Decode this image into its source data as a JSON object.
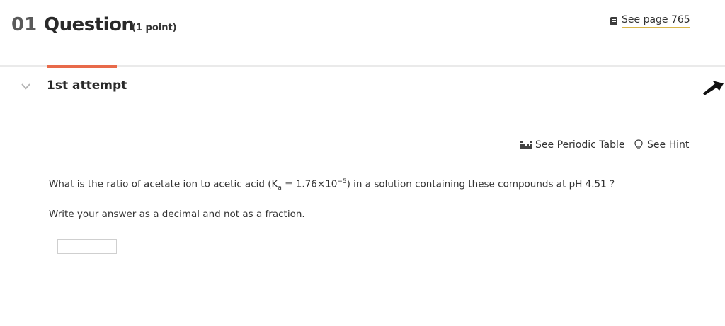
{
  "header": {
    "number": "01",
    "title": "Question",
    "points": "(1 point)",
    "see_page": "See page 765"
  },
  "attempt": {
    "title": "1st attempt"
  },
  "tools": {
    "periodic_table": "See Periodic Table",
    "hint": "See Hint"
  },
  "question": {
    "part1": "What is the ratio of acetate ion to acetic acid (K",
    "sub": "a",
    "part2": " = 1.76×10",
    "sup": "−5",
    "part3": ") in a solution containing these compounds at pH 4.51 ?",
    "instruction": "Write your answer as a decimal and not as a fraction."
  },
  "answer": {
    "value": ""
  },
  "colors": {
    "accent": "#e86a4a",
    "link_underline": "#d9b64a"
  }
}
